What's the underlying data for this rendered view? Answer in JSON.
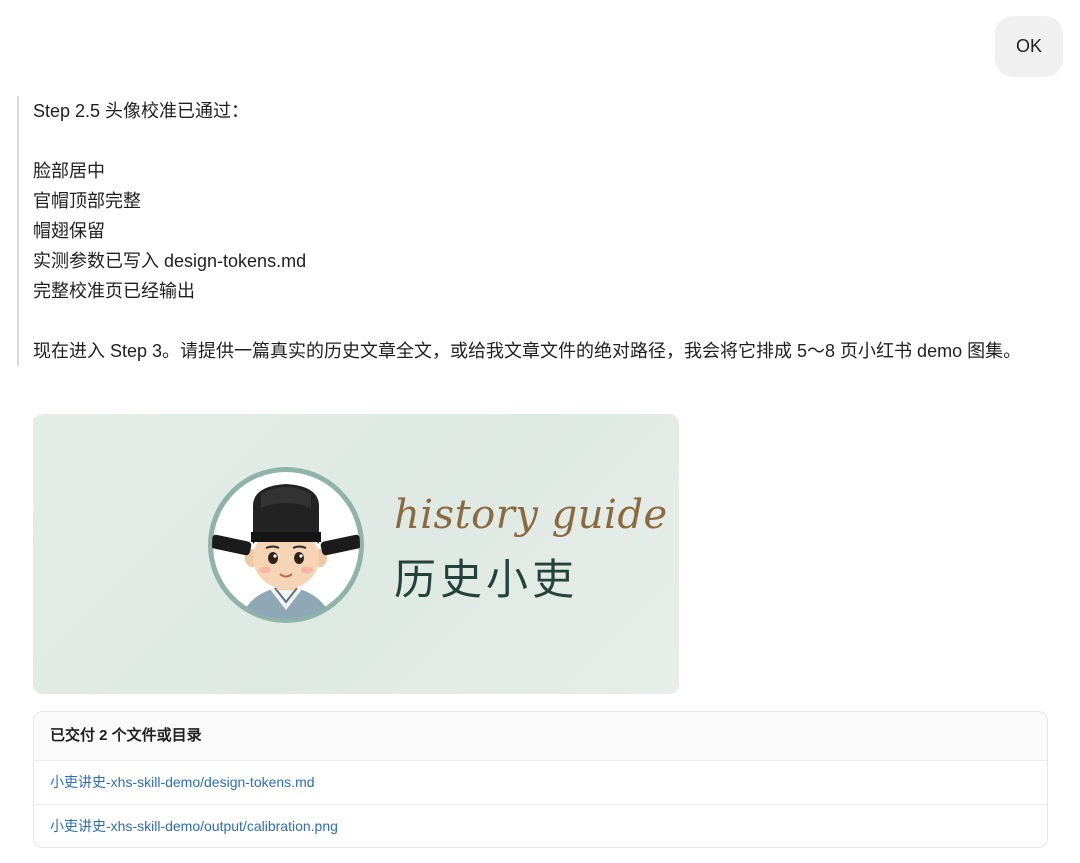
{
  "user_message": {
    "text": "OK"
  },
  "assistant_message": {
    "intro": "Step 2.5 头像校准已通过：",
    "checklist": [
      "脸部居中",
      "官帽顶部完整",
      "帽翅保留",
      "实测参数已写入 design-tokens.md",
      "完整校准页已经输出"
    ],
    "next_step": "现在进入 Step 3。请提供一篇真实的历史文章全文，或给我文章文件的绝对路径，我会将它排成 5～8 页小红书 demo 图集。"
  },
  "calibration_image": {
    "brand_en": "history guide",
    "brand_zh": "历史小吏",
    "colors": {
      "background": "#e2ebe5",
      "ring": "#8fb3a8",
      "en_text": "#8a6a3e",
      "zh_text": "#24413a"
    }
  },
  "delivered_files": {
    "header": "已交付 2 个文件或目录",
    "files": [
      "小吏讲史-xhs-skill-demo/design-tokens.md",
      "小吏讲史-xhs-skill-demo/output/calibration.png"
    ],
    "link_color": "#2a6ebb"
  }
}
